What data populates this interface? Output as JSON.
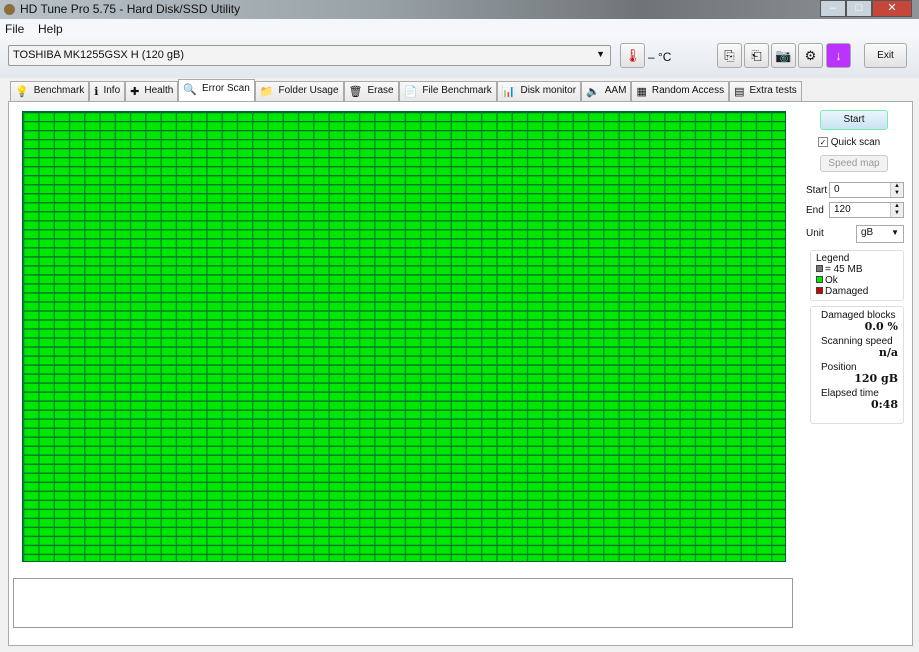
{
  "window": {
    "title": "HD Tune Pro 5.75 - Hard Disk/SSD Utility"
  },
  "menu": [
    "File",
    "Help"
  ],
  "toolbar": {
    "drive": "TOSHIBA MK1255GSX H (120 gB)",
    "temperature": "– °C",
    "exit": "Exit"
  },
  "tabs": [
    {
      "label": "Benchmark",
      "icon": "💡"
    },
    {
      "label": "Info",
      "icon": "ℹ"
    },
    {
      "label": "Health",
      "icon": "✚"
    },
    {
      "label": "Error Scan",
      "icon": "🔍"
    },
    {
      "label": "Folder Usage",
      "icon": "📁"
    },
    {
      "label": "Erase",
      "icon": "🗑"
    },
    {
      "label": "File Benchmark",
      "icon": "📄"
    },
    {
      "label": "Disk monitor",
      "icon": "📊"
    },
    {
      "label": "AAM",
      "icon": "🔈"
    },
    {
      "label": "Random Access",
      "icon": "▦"
    },
    {
      "label": "Extra tests",
      "icon": "▤"
    }
  ],
  "active_tab": "Error Scan",
  "side": {
    "start_button": "Start",
    "quick_scan": "Quick scan",
    "quick_scan_checked": true,
    "speed_map": "Speed map",
    "start_label": "Start",
    "start_value": "0",
    "end_label": "End",
    "end_value": "120",
    "unit_label": "Unit",
    "unit_value": "gB",
    "legend_title": "Legend",
    "legend_block": "= 45 MB",
    "legend_ok": "Ok",
    "legend_damaged": "Damaged",
    "damaged_label": "Damaged blocks",
    "damaged_value": "0.0 %",
    "speed_label": "Scanning speed",
    "speed_value": "n/a",
    "position_label": "Position",
    "position_value": "120 gB",
    "elapsed_label": "Elapsed time",
    "elapsed_value": "0:48"
  },
  "colors": {
    "ok": "#00e800",
    "damaged": "#cc0000",
    "block": "#777777"
  }
}
